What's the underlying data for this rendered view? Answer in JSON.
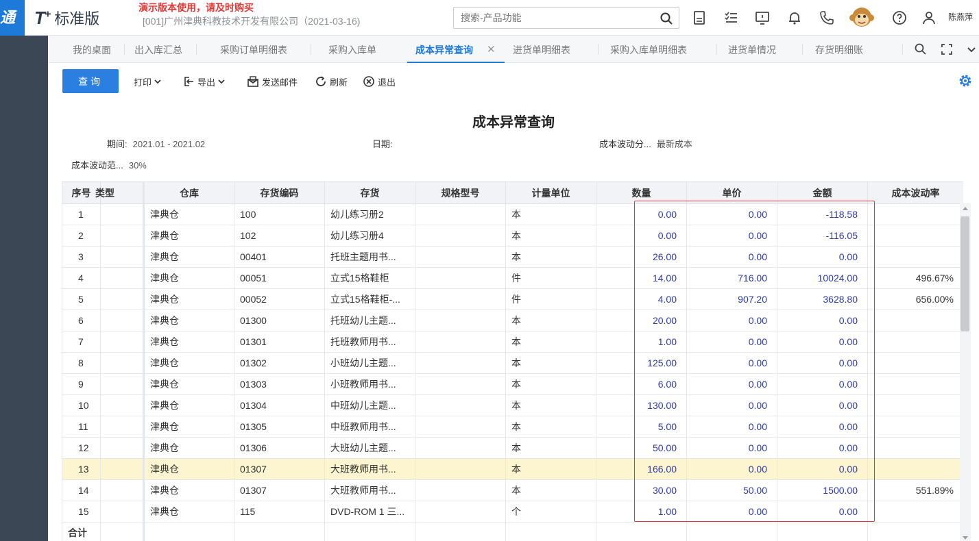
{
  "app": {
    "logo_tile": "通",
    "brand_mark": "T",
    "brand_plus": "+",
    "edition": "标准版",
    "demo_note": "演示版本使用，请及时购买",
    "company": "[001]广州津典科教技术开发有限公司（2021-03-16)",
    "username": "陈燕萍"
  },
  "search": {
    "placeholder": "搜索-产品功能"
  },
  "header_icons": [
    "calculator-icon",
    "checklist-icon",
    "message-icon",
    "bell-icon",
    "phone-icon",
    "help-icon",
    "user-icon"
  ],
  "tabs": [
    {
      "label": "我的桌面"
    },
    {
      "label": "出入库汇总"
    },
    {
      "label": "采购订单明细表"
    },
    {
      "label": "采购入库单"
    },
    {
      "label": "成本异常查询",
      "active": true
    },
    {
      "label": "进货单明细表"
    },
    {
      "label": "采购入库单明细表"
    },
    {
      "label": "进货单情况"
    },
    {
      "label": "存货明细账"
    }
  ],
  "tab_close_glyph": "✕",
  "toolbar": {
    "query": "查询",
    "print": "打印",
    "export": "导出",
    "send_mail": "发送邮件",
    "refresh": "刷新",
    "exit": "退出"
  },
  "report": {
    "title": "成本异常查询",
    "period_label": "期间:",
    "period_value": "2021.01 - 2021.02",
    "date_label": "日期:",
    "date_value": "",
    "analysis_label": "成本波动分...",
    "analysis_value": "最新成本",
    "range_label": "成本波动范...",
    "range_value": "30%"
  },
  "table": {
    "columns": [
      "序号",
      "类型",
      "仓库",
      "存货编码",
      "存货",
      "规格型号",
      "计量单位",
      "数量",
      "单价",
      "金额",
      "成本波动率"
    ],
    "rows": [
      [
        "1",
        "",
        "津典仓",
        "100",
        "幼儿练习册2",
        "",
        "本",
        "0.00",
        "0.00",
        "-118.58",
        ""
      ],
      [
        "2",
        "",
        "津典仓",
        "102",
        "幼儿练习册4",
        "",
        "本",
        "0.00",
        "0.00",
        "-116.05",
        ""
      ],
      [
        "3",
        "",
        "津典仓",
        "00401",
        "托班主题用书...",
        "",
        "本",
        "26.00",
        "0.00",
        "0.00",
        ""
      ],
      [
        "4",
        "",
        "津典仓",
        "00051",
        "立式15格鞋柜",
        "",
        "件",
        "14.00",
        "716.00",
        "10024.00",
        "496.67%"
      ],
      [
        "5",
        "",
        "津典仓",
        "00052",
        "立式15格鞋柜-...",
        "",
        "件",
        "4.00",
        "907.20",
        "3628.80",
        "656.00%"
      ],
      [
        "6",
        "",
        "津典仓",
        "01300",
        "托班幼儿主题...",
        "",
        "本",
        "20.00",
        "0.00",
        "0.00",
        ""
      ],
      [
        "7",
        "",
        "津典仓",
        "01301",
        "托班教师用书...",
        "",
        "本",
        "1.00",
        "0.00",
        "0.00",
        ""
      ],
      [
        "8",
        "",
        "津典仓",
        "01302",
        "小班幼儿主题...",
        "",
        "本",
        "125.00",
        "0.00",
        "0.00",
        ""
      ],
      [
        "9",
        "",
        "津典仓",
        "01303",
        "小班教师用书...",
        "",
        "本",
        "6.00",
        "0.00",
        "0.00",
        ""
      ],
      [
        "10",
        "",
        "津典仓",
        "01304",
        "中班幼儿主题...",
        "",
        "本",
        "130.00",
        "0.00",
        "0.00",
        ""
      ],
      [
        "11",
        "",
        "津典仓",
        "01305",
        "中班教师用书...",
        "",
        "本",
        "5.00",
        "0.00",
        "0.00",
        ""
      ],
      [
        "12",
        "",
        "津典仓",
        "01306",
        "大班幼儿主题...",
        "",
        "本",
        "50.00",
        "0.00",
        "0.00",
        ""
      ],
      [
        "13",
        "",
        "津典仓",
        "01307",
        "大班教师用书...",
        "",
        "本",
        "166.00",
        "0.00",
        "0.00",
        ""
      ],
      [
        "14",
        "",
        "津典仓",
        "01307",
        "大班教师用书...",
        "",
        "本",
        "30.00",
        "50.00",
        "1500.00",
        "551.89%"
      ],
      [
        "15",
        "",
        "津典仓",
        "115",
        "DVD-ROM 1 三...",
        "",
        "个",
        "1.00",
        "0.00",
        "0.00",
        ""
      ]
    ],
    "highlighted_row": 13,
    "total_label": "合计"
  },
  "colors": {
    "brand_blue": "#2b7fe0",
    "sidebar": "#3b4754",
    "numeric_text": "#2e3aa8",
    "highlight_row": "#fdf5cf",
    "annotation_box": "#e0383e",
    "demo_note": "#e53935"
  }
}
